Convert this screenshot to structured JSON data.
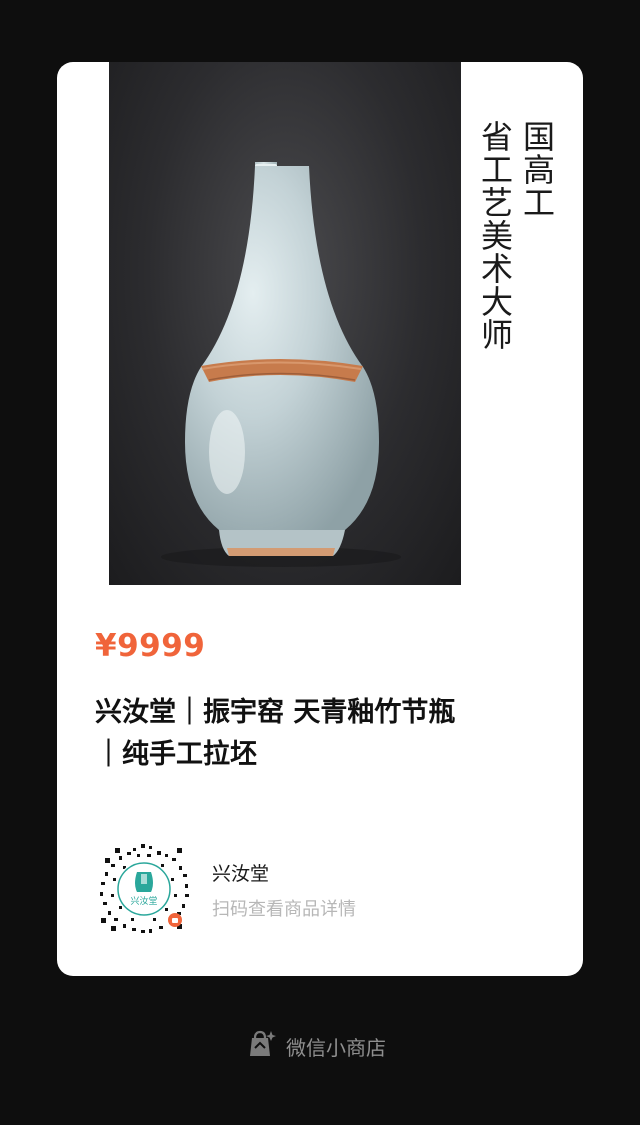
{
  "product": {
    "vertical_caption": [
      "国高工",
      "省工艺美术大师"
    ],
    "price": "¥9999",
    "title_line1": "兴汝堂｜振宇窑 天青釉竹节瓶",
    "title_line2": "｜纯手工拉坯"
  },
  "store": {
    "name": "兴汝堂",
    "scan_hint": "扫码查看商品详情",
    "logo_text": "兴汝堂"
  },
  "footer": {
    "label": "微信小商店",
    "icon": "shopping-bag-icon"
  },
  "colors": {
    "price": "#f0643a",
    "background": "#0e0e0e",
    "card": "#ffffff",
    "glaze": "#c3d2d6",
    "band": "#c77b4c",
    "logo": "#2aa79b"
  }
}
